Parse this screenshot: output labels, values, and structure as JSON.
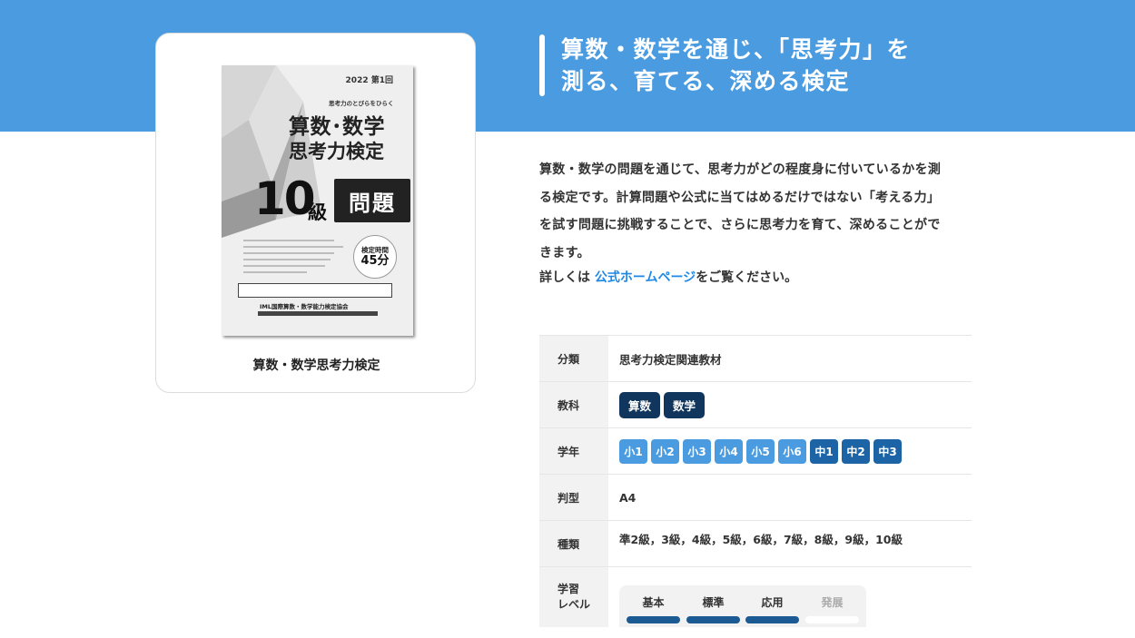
{
  "header": {
    "heading_line1": "算数・数学を通じ、「思考力」を",
    "heading_line2": "測る、育てる、深める検定"
  },
  "product": {
    "title": "算数・数学思考力検定",
    "cover": {
      "edition": "2022 第1回",
      "tagline": "思考力のとびらをひらく",
      "subject": "算数･数学",
      "test_name": "思考力検定",
      "grade_number": "10",
      "grade_unit": "級",
      "booklet_type": "問題",
      "time_label": "検定時間",
      "time_value": "45分",
      "organization": "IML国際算数・数学能力検定協会"
    }
  },
  "description": {
    "line1": "算数・数学の問題を通じて、思考力がどの程度身に付いているかを測",
    "line2": "る検定です。計算問題や公式に当てはめるだけではない「考える力」",
    "line3": "を試す問題に挑戦することで、さらに思考力を育て、深めることがで",
    "line4": "きます。",
    "more_prefix": "詳しくは ",
    "more_link": "公式ホームページ",
    "more_suffix": "をご覧ください。"
  },
  "spec": {
    "category": {
      "label": "分類",
      "value": "思考力検定関連教材"
    },
    "subjects": {
      "label": "教科",
      "items": [
        "算数",
        "数学"
      ]
    },
    "grades": {
      "label": "学年",
      "elementary": [
        "小1",
        "小2",
        "小3",
        "小4",
        "小5",
        "小6"
      ],
      "middle": [
        "中1",
        "中2",
        "中3"
      ]
    },
    "format": {
      "label": "判型",
      "value": "A4"
    },
    "levels_kind": {
      "label": "種類",
      "value": "準2級，3級，4級，5級，6級，7級，8級，9級，10級"
    },
    "study_level": {
      "label": "学習\nレベル",
      "items": [
        {
          "name": "基本",
          "active": true
        },
        {
          "name": "標準",
          "active": true
        },
        {
          "name": "応用",
          "active": true
        },
        {
          "name": "発展",
          "active": false
        }
      ]
    }
  },
  "colors": {
    "header_band": "#4a9be0",
    "link": "#1f87e5",
    "subject_tag": "#10365e",
    "elementary_chip": "#4a9be0",
    "middle_chip": "#1d64a6",
    "level_active": "#1c5a94"
  }
}
